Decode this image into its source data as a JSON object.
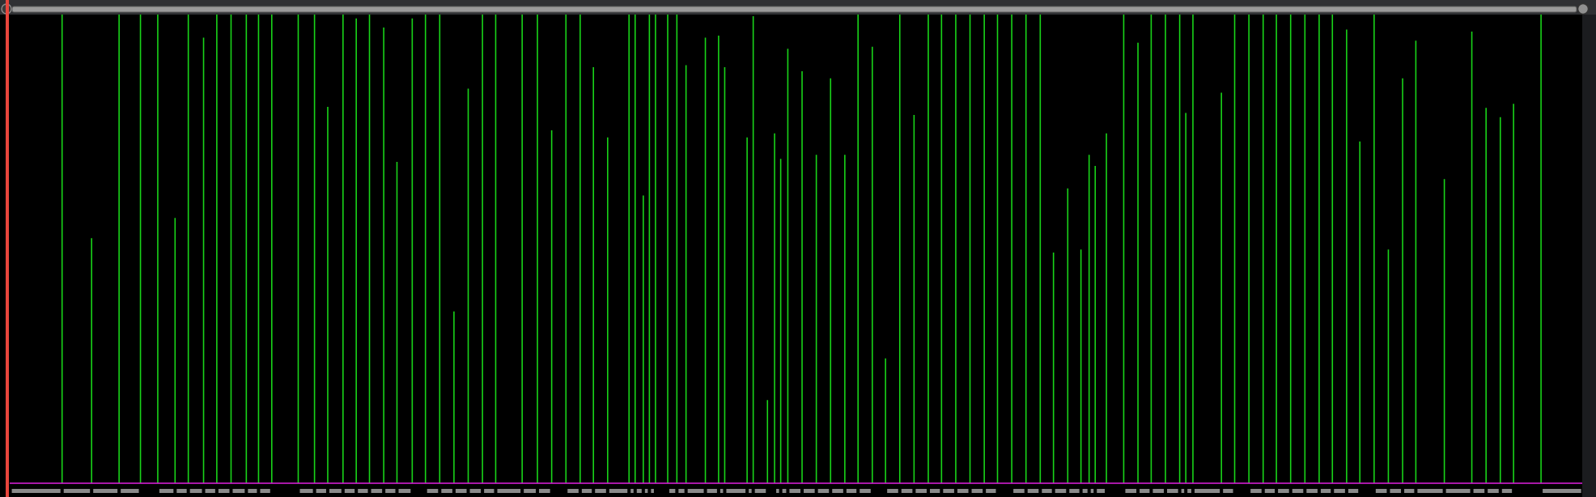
{
  "timeline": {
    "kind": "spike-plot"
  }
}
